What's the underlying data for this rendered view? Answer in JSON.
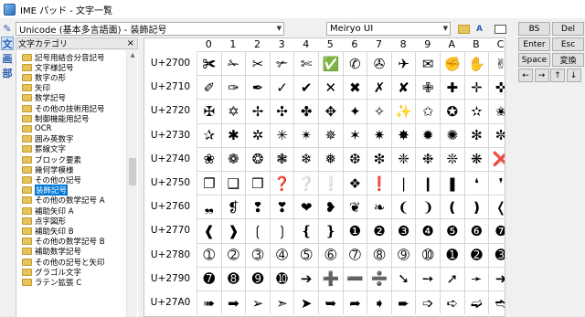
{
  "window": {
    "title": "IME パッド - 文字一覧"
  },
  "left_icons": [
    {
      "label": "✎",
      "name": "handwriting-icon"
    },
    {
      "label": "文",
      "name": "char-list-icon",
      "selected": true
    },
    {
      "label": "画",
      "name": "strokes-icon"
    },
    {
      "label": "部",
      "name": "radical-icon"
    }
  ],
  "unicode_select": {
    "value": "Unicode (基本多言語面) - 装飾記号"
  },
  "font_select": {
    "value": "Meiryo UI"
  },
  "category_panel": {
    "title": "文字カテゴリ",
    "close": "×"
  },
  "categories": [
    "記号用結合分音記号",
    "文字様記号",
    "数字の形",
    "矢印",
    "数学記号",
    "その他の技術用記号",
    "制御機能用記号",
    "OCR",
    "囲み英数字",
    "罫線文字",
    "ブロック要素",
    "幾何学模様",
    "その他の記号",
    "装飾記号",
    "その他の数学記号 A",
    "補助矢印 A",
    "点字図形",
    "補助矢印 B",
    "その他の数学記号 B",
    "補助数学記号",
    "その他の記号と矢印",
    "グラゴル文字",
    "ラテン拡張 C"
  ],
  "selected_category": "装飾記号",
  "grid": {
    "columns": [
      "0",
      "1",
      "2",
      "3",
      "4",
      "5",
      "6",
      "7",
      "8",
      "9",
      "A",
      "B",
      "C"
    ],
    "rows": [
      {
        "label": "U+2700",
        "chars": [
          "✀",
          "✁",
          "✂",
          "✃",
          "✄",
          "✅",
          "✆",
          "✇",
          "✈",
          "✉",
          "✊",
          "✋",
          "✌"
        ]
      },
      {
        "label": "U+2710",
        "chars": [
          "✐",
          "✑",
          "✒",
          "✓",
          "✔",
          "✕",
          "✖",
          "✗",
          "✘",
          "✙",
          "✚",
          "✛",
          "✜"
        ]
      },
      {
        "label": "U+2720",
        "chars": [
          "✠",
          "✡",
          "✢",
          "✣",
          "✤",
          "✥",
          "✦",
          "✧",
          "✨",
          "✩",
          "✪",
          "✫",
          "✬"
        ]
      },
      {
        "label": "U+2730",
        "chars": [
          "✰",
          "✱",
          "✲",
          "✳",
          "✴",
          "✵",
          "✶",
          "✷",
          "✸",
          "✹",
          "✺",
          "✻",
          "✼"
        ]
      },
      {
        "label": "U+2740",
        "chars": [
          "❀",
          "❁",
          "❂",
          "❃",
          "❄",
          "❅",
          "❆",
          "❇",
          "❈",
          "❉",
          "❊",
          "❋",
          "❌"
        ]
      },
      {
        "label": "U+2750",
        "chars": [
          "❐",
          "❑",
          "❒",
          "❓",
          "❔",
          "❕",
          "❖",
          "❗",
          "❘",
          "❙",
          "❚",
          "❛",
          "❜"
        ]
      },
      {
        "label": "U+2760",
        "chars": [
          "❠",
          "❡",
          "❢",
          "❣",
          "❤",
          "❥",
          "❦",
          "❧",
          "❨",
          "❩",
          "❪",
          "❫",
          "❬"
        ]
      },
      {
        "label": "U+2770",
        "chars": [
          "❰",
          "❱",
          "❲",
          "❳",
          "❴",
          "❵",
          "❶",
          "❷",
          "❸",
          "❹",
          "❺",
          "❻",
          "❼"
        ]
      },
      {
        "label": "U+2780",
        "chars": [
          "➀",
          "➁",
          "➂",
          "➃",
          "➄",
          "➅",
          "➆",
          "➇",
          "➈",
          "➉",
          "➊",
          "➋",
          "➌"
        ]
      },
      {
        "label": "U+2790",
        "chars": [
          "➐",
          "➑",
          "➒",
          "➓",
          "➔",
          "➕",
          "➖",
          "➗",
          "➘",
          "➙",
          "➚",
          "➛",
          "➜"
        ]
      },
      {
        "label": "U+27A0",
        "chars": [
          "➠",
          "➡",
          "➢",
          "➣",
          "➤",
          "➥",
          "➦",
          "➧",
          "➨",
          "➩",
          "➪",
          "➫",
          "➬"
        ]
      }
    ]
  },
  "buttons": [
    {
      "label": "BS",
      "name": "backspace-button"
    },
    {
      "label": "Del",
      "name": "delete-button"
    },
    {
      "label": "Enter",
      "name": "enter-button"
    },
    {
      "label": "Esc",
      "name": "escape-button"
    },
    {
      "label": "Space",
      "name": "space-button"
    },
    {
      "label": "変換",
      "name": "convert-button"
    },
    {
      "label": "←",
      "name": "left-arrow-button"
    },
    {
      "label": "→",
      "name": "right-arrow-button"
    },
    {
      "label": "↑",
      "name": "up-arrow-button"
    },
    {
      "label": "↓",
      "name": "down-arrow-button"
    }
  ]
}
